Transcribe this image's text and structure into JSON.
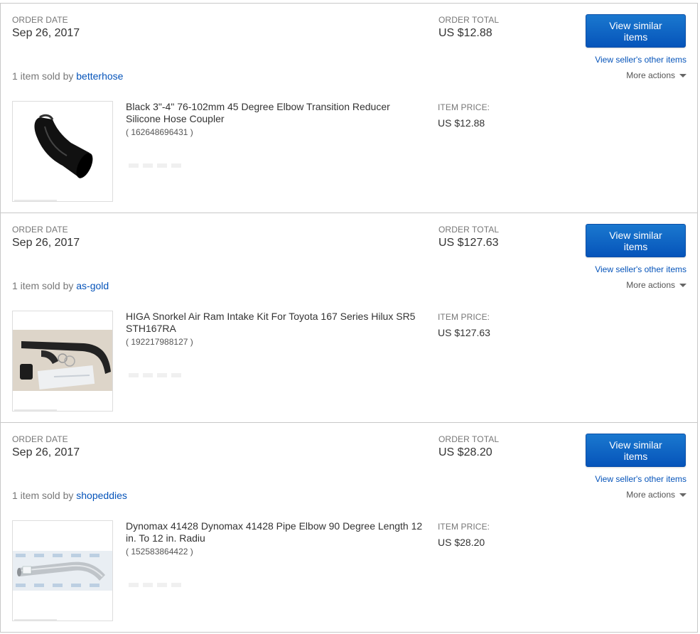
{
  "orders": [
    {
      "order_date_label": "ORDER DATE",
      "order_date": "Sep 26, 2017",
      "order_total_label": "ORDER TOTAL",
      "order_total": "US $12.88",
      "view_similar_label": "View similar items",
      "seller_other_label": "View seller's other items",
      "more_actions_label": "More actions",
      "sold_by_prefix": "1 item sold by",
      "seller": "betterhose",
      "item_title": "Black 3\"-4\" 76-102mm 45 Degree Elbow Transition Reducer Silicone Hose Coupler",
      "item_id": "( 162648696431 )",
      "item_price_label": "ITEM PRICE:",
      "item_price": "US $12.88",
      "thumb_icon": "silicone-hose-elbow-photo"
    },
    {
      "order_date_label": "ORDER DATE",
      "order_date": "Sep 26, 2017",
      "order_total_label": "ORDER TOTAL",
      "order_total": "US $127.63",
      "view_similar_label": "View similar items",
      "seller_other_label": "View seller's other items",
      "more_actions_label": "More actions",
      "sold_by_prefix": "1 item sold by",
      "seller": "as-gold",
      "item_title": "HIGA Snorkel Air Ram Intake Kit For Toyota 167 Series Hilux SR5 STH167RA",
      "item_id": "( 192217988127 )",
      "item_price_label": "ITEM PRICE:",
      "item_price": "US $127.63",
      "thumb_icon": "snorkel-kit-photo"
    },
    {
      "order_date_label": "ORDER DATE",
      "order_date": "Sep 26, 2017",
      "order_total_label": "ORDER TOTAL",
      "order_total": "US $28.20",
      "view_similar_label": "View similar items",
      "seller_other_label": "View seller's other items",
      "more_actions_label": "More actions",
      "sold_by_prefix": "1 item sold by",
      "seller": "shopeddies",
      "item_title": "Dynomax 41428 Dynomax 41428 Pipe Elbow 90 Degree Length 12 in. To 12 in. Radiu",
      "item_id": "( 152583864422 )",
      "item_price_label": "ITEM PRICE:",
      "item_price": "US $28.20",
      "thumb_icon": "pipe-elbow-photo"
    }
  ],
  "colors": {
    "link": "#0654ba",
    "button": "#0654ba",
    "muted": "#777777"
  }
}
